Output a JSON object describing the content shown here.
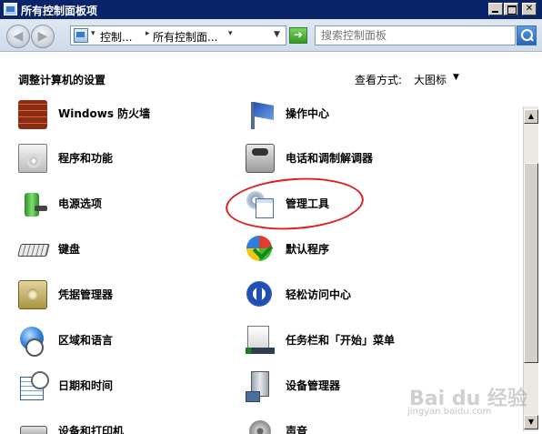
{
  "window": {
    "title": "所有控制面板项"
  },
  "address_bar": {
    "crumbs": [
      "控制...",
      "所有控制面..."
    ],
    "search_placeholder": "搜索控制面板",
    "refresh_icon": "green-arrow-refresh-icon",
    "search_icon": "magnifier-icon"
  },
  "header": {
    "title": "调整计算机的设置",
    "view_label": "查看方式:",
    "view_value": "大图标"
  },
  "items": [
    {
      "label": "Windows 防火墙",
      "icon": "firewall-brick-wall-icon"
    },
    {
      "label": "操作中心",
      "icon": "action-center-flag-icon"
    },
    {
      "label": "程序和功能",
      "icon": "programs-features-icon"
    },
    {
      "label": "电话和调制解调器",
      "icon": "phone-modem-icon"
    },
    {
      "label": "电源选项",
      "icon": "power-battery-icon"
    },
    {
      "label": "管理工具",
      "icon": "admin-tools-gear-icon"
    },
    {
      "label": "键盘",
      "icon": "keyboard-icon"
    },
    {
      "label": "默认程序",
      "icon": "default-programs-icon"
    },
    {
      "label": "凭据管理器",
      "icon": "credential-vault-icon"
    },
    {
      "label": "轻松访问中心",
      "icon": "ease-of-access-icon"
    },
    {
      "label": "区域和语言",
      "icon": "globe-clock-icon"
    },
    {
      "label": "任务栏和「开始」菜单",
      "icon": "taskbar-start-menu-icon"
    },
    {
      "label": "日期和时间",
      "icon": "calendar-clock-icon"
    },
    {
      "label": "设备管理器",
      "icon": "device-manager-icon"
    },
    {
      "label": "设备和打印机",
      "icon": "printer-icon"
    },
    {
      "label": "声音",
      "icon": "speaker-icon"
    }
  ],
  "annotation": {
    "color": "#e01e1e",
    "highlighted_item": "管理工具"
  },
  "watermark": {
    "text": "Bai du 经验",
    "sub": "jingyan.baidu.com"
  },
  "colors": {
    "titlebar": "#0a246a",
    "toolbar": "#dfe7f2"
  }
}
